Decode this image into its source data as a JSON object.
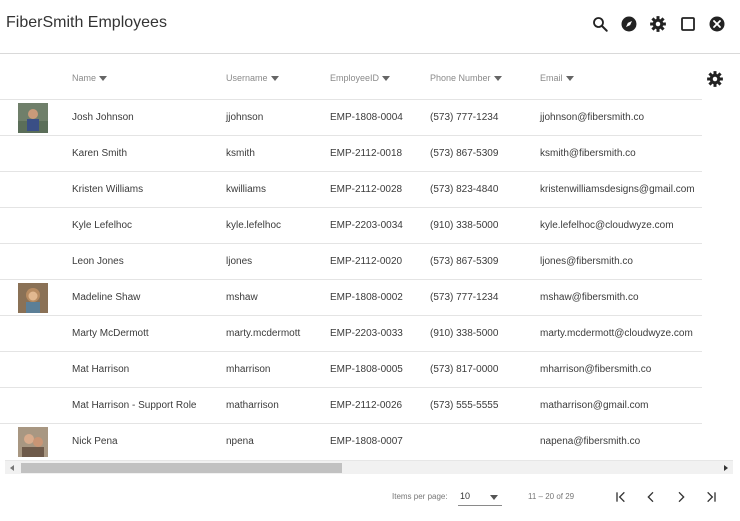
{
  "app": {
    "title": "FiberSmith Employees"
  },
  "header_icons": [
    "search-icon",
    "compass-icon",
    "gear-icon",
    "maximize-icon",
    "close-icon"
  ],
  "table": {
    "columns": [
      "Name",
      "Username",
      "EmployeeID",
      "Phone Number",
      "Email"
    ],
    "rows": [
      {
        "name": "Josh Johnson",
        "username": "jjohnson",
        "employee_id": "EMP-1808-0004",
        "phone": "(573) 777-1234",
        "email": "jjohnson@fibersmith.co",
        "has_avatar": true
      },
      {
        "name": "Karen Smith",
        "username": "ksmith",
        "employee_id": "EMP-2112-0018",
        "phone": "(573) 867-5309",
        "email": "ksmith@fibersmith.co",
        "has_avatar": false
      },
      {
        "name": "Kristen Williams",
        "username": "kwilliams",
        "employee_id": "EMP-2112-0028",
        "phone": "(573) 823-4840",
        "email": "kristenwilliamsdesigns@gmail.com",
        "has_avatar": false
      },
      {
        "name": "Kyle Lefelhoc",
        "username": "kyle.lefelhoc",
        "employee_id": "EMP-2203-0034",
        "phone": "(910) 338-5000",
        "email": "kyle.lefelhoc@cloudwyze.com",
        "has_avatar": false
      },
      {
        "name": "Leon Jones",
        "username": "ljones",
        "employee_id": "EMP-2112-0020",
        "phone": "(573) 867-5309",
        "email": "ljones@fibersmith.co",
        "has_avatar": false
      },
      {
        "name": "Madeline Shaw",
        "username": "mshaw",
        "employee_id": "EMP-1808-0002",
        "phone": "(573) 777-1234",
        "email": "mshaw@fibersmith.co",
        "has_avatar": true
      },
      {
        "name": "Marty McDermott",
        "username": "marty.mcdermott",
        "employee_id": "EMP-2203-0033",
        "phone": "(910) 338-5000",
        "email": "marty.mcdermott@cloudwyze.com",
        "has_avatar": false
      },
      {
        "name": "Mat Harrison",
        "username": "mharrison",
        "employee_id": "EMP-1808-0005",
        "phone": "(573) 817-0000",
        "email": "mharrison@fibersmith.co",
        "has_avatar": false
      },
      {
        "name": "Mat Harrison - Support Role",
        "username": "matharrison",
        "employee_id": "EMP-2112-0026",
        "phone": "(573) 555-5555",
        "email": "matharrison@gmail.com",
        "has_avatar": false
      },
      {
        "name": "Nick Pena",
        "username": "npena",
        "employee_id": "EMP-1808-0007",
        "phone": "",
        "email": "napena@fibersmith.co",
        "has_avatar": true
      }
    ]
  },
  "paginator": {
    "items_per_page_label": "Items per page:",
    "items_per_page_value": "10",
    "range_label": "11 – 20 of 29"
  },
  "colors": {
    "icon": "#222222",
    "border": "#e4e4e4",
    "scroll_thumb": "#c1c1c1"
  }
}
